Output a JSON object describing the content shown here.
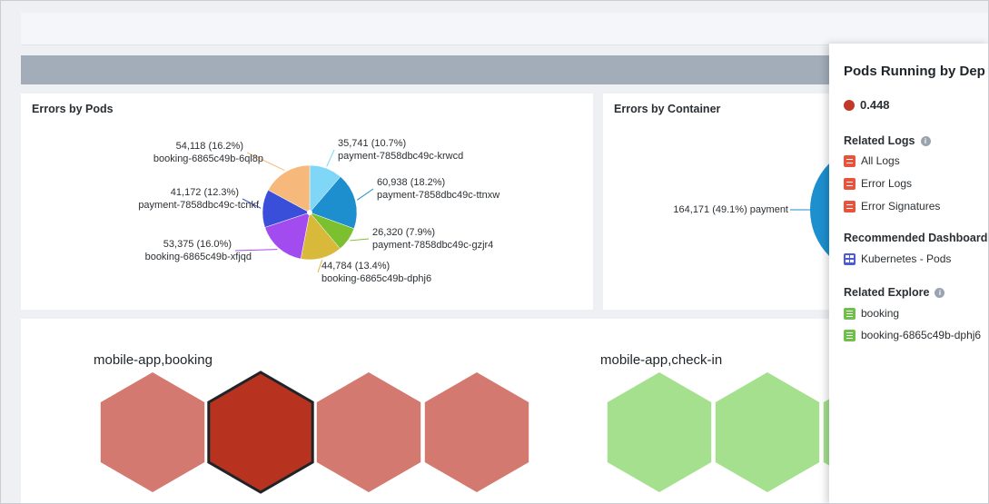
{
  "panels": {
    "errors_by_pods": {
      "title": "Errors by Pods",
      "labels": [
        {
          "value": "35,741 (10.7%)",
          "name": "payment-7858dbc49c-krwcd"
        },
        {
          "value": "60,938 (18.2%)",
          "name": "payment-7858dbc49c-ttnxw"
        },
        {
          "value": "26,320 (7.9%)",
          "name": "payment-7858dbc49c-gzjr4"
        },
        {
          "value": "44,784 (13.4%)",
          "name": "booking-6865c49b-dphj6"
        },
        {
          "value": "53,375 (16.0%)",
          "name": "booking-6865c49b-xfjqd"
        },
        {
          "value": "41,172 (12.3%)",
          "name": "payment-7858dbc49c-tcnkf"
        },
        {
          "value": "54,118 (16.2%)",
          "name": "booking-6865c49b-6ql8p"
        }
      ]
    },
    "errors_by_container": {
      "title": "Errors by Container",
      "label": "164,171 (49.1%) payment"
    }
  },
  "chart_data": [
    {
      "type": "pie",
      "title": "Errors by Pods",
      "categories": [
        "payment-7858dbc49c-krwcd",
        "payment-7858dbc49c-ttnxw",
        "payment-7858dbc49c-gzjr4",
        "booking-6865c49b-dphj6",
        "booking-6865c49b-xfjqd",
        "payment-7858dbc49c-tcnkf",
        "booking-6865c49b-6ql8p"
      ],
      "values": [
        35741,
        60938,
        26320,
        44784,
        53375,
        41172,
        54118
      ],
      "percentages": [
        10.7,
        18.2,
        7.9,
        13.4,
        16.0,
        12.3,
        16.2
      ],
      "colors": [
        "#7fd6f7",
        "#1e8fce",
        "#7cbf2f",
        "#d8b93a",
        "#a24cf0",
        "#3a4fd9",
        "#f7b97b",
        "#8c8ff5"
      ]
    },
    {
      "type": "pie",
      "title": "Errors by Container",
      "categories": [
        "payment"
      ],
      "values": [
        164171
      ],
      "percentages": [
        49.1
      ]
    }
  ],
  "honeycomb": {
    "groups": [
      {
        "label": "mobile-app,booking",
        "status": "error"
      },
      {
        "label": "mobile-app,check-in",
        "status": "ok"
      }
    ],
    "colors": {
      "error_light": "#d4796f",
      "error_selected": "#b83220",
      "ok": "#a4e08e",
      "selected_border": "#1f2428"
    }
  },
  "side_panel": {
    "title": "Pods Running by Dep",
    "metric_value": "0.448",
    "metric_color": "#c0392b",
    "related_logs": {
      "heading": "Related Logs",
      "items": [
        "All Logs",
        "Error Logs",
        "Error Signatures"
      ]
    },
    "recommended_dashboards": {
      "heading": "Recommended Dashboard",
      "items": [
        "Kubernetes - Pods"
      ]
    },
    "related_explore": {
      "heading": "Related Explore",
      "items": [
        "booking",
        "booking-6865c49b-dphj6"
      ]
    },
    "info_icon": "info-icon"
  }
}
